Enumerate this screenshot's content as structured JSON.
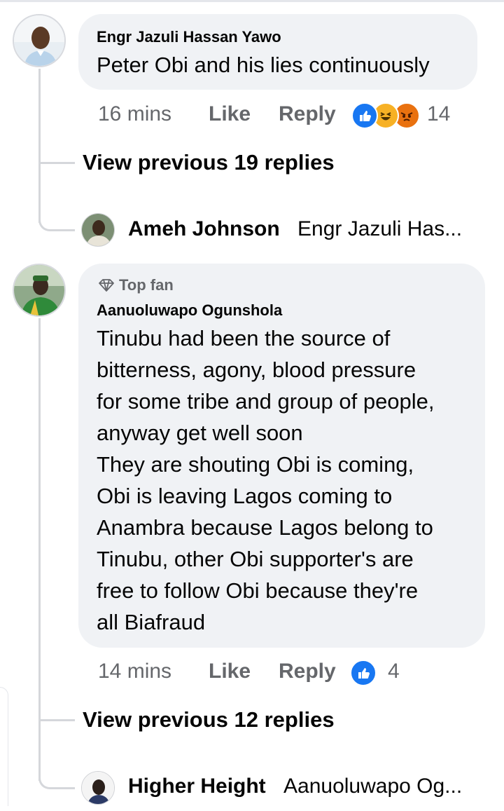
{
  "comments": [
    {
      "author": "Engr Jazuli Hassan Yawo",
      "text_lines": [
        "Peter Obi and his lies continuously"
      ],
      "time": "16 mins",
      "like_label": "Like",
      "reply_label": "Reply",
      "reactions": [
        "like-icon",
        "haha-icon",
        "angry-icon"
      ],
      "reaction_count": "14",
      "view_previous": "View previous 19 replies",
      "latest_reply": {
        "author": "Ameh Johnson",
        "snippet": "Engr Jazuli Has..."
      }
    },
    {
      "badge": "Top fan",
      "author": "Aanuoluwapo Ogunshola",
      "text_lines": [
        "Tinubu had been the source of",
        "bitterness, agony, blood pressure",
        "for some tribe and group of people,",
        "anyway get well soon",
        "They are shouting Obi is coming,",
        "Obi is leaving Lagos coming to",
        "Anambra because Lagos belong to",
        "Tinubu, other Obi supporter's are",
        "free to follow Obi because they're",
        "all Biafraud"
      ],
      "time": "14 mins",
      "like_label": "Like",
      "reply_label": "Reply",
      "reactions": [
        "like-icon"
      ],
      "reaction_count": "4",
      "view_previous": "View previous 12 replies",
      "latest_reply": {
        "author": "Higher Height",
        "snippet": "Aanuoluwapo Og..."
      }
    }
  ],
  "colors": {
    "bubble": "#f0f2f5",
    "meta_text": "#65676b",
    "like_blue": "#1877f2",
    "haha_yellow": "#f7b125",
    "angry_orange": "#e9710f"
  }
}
